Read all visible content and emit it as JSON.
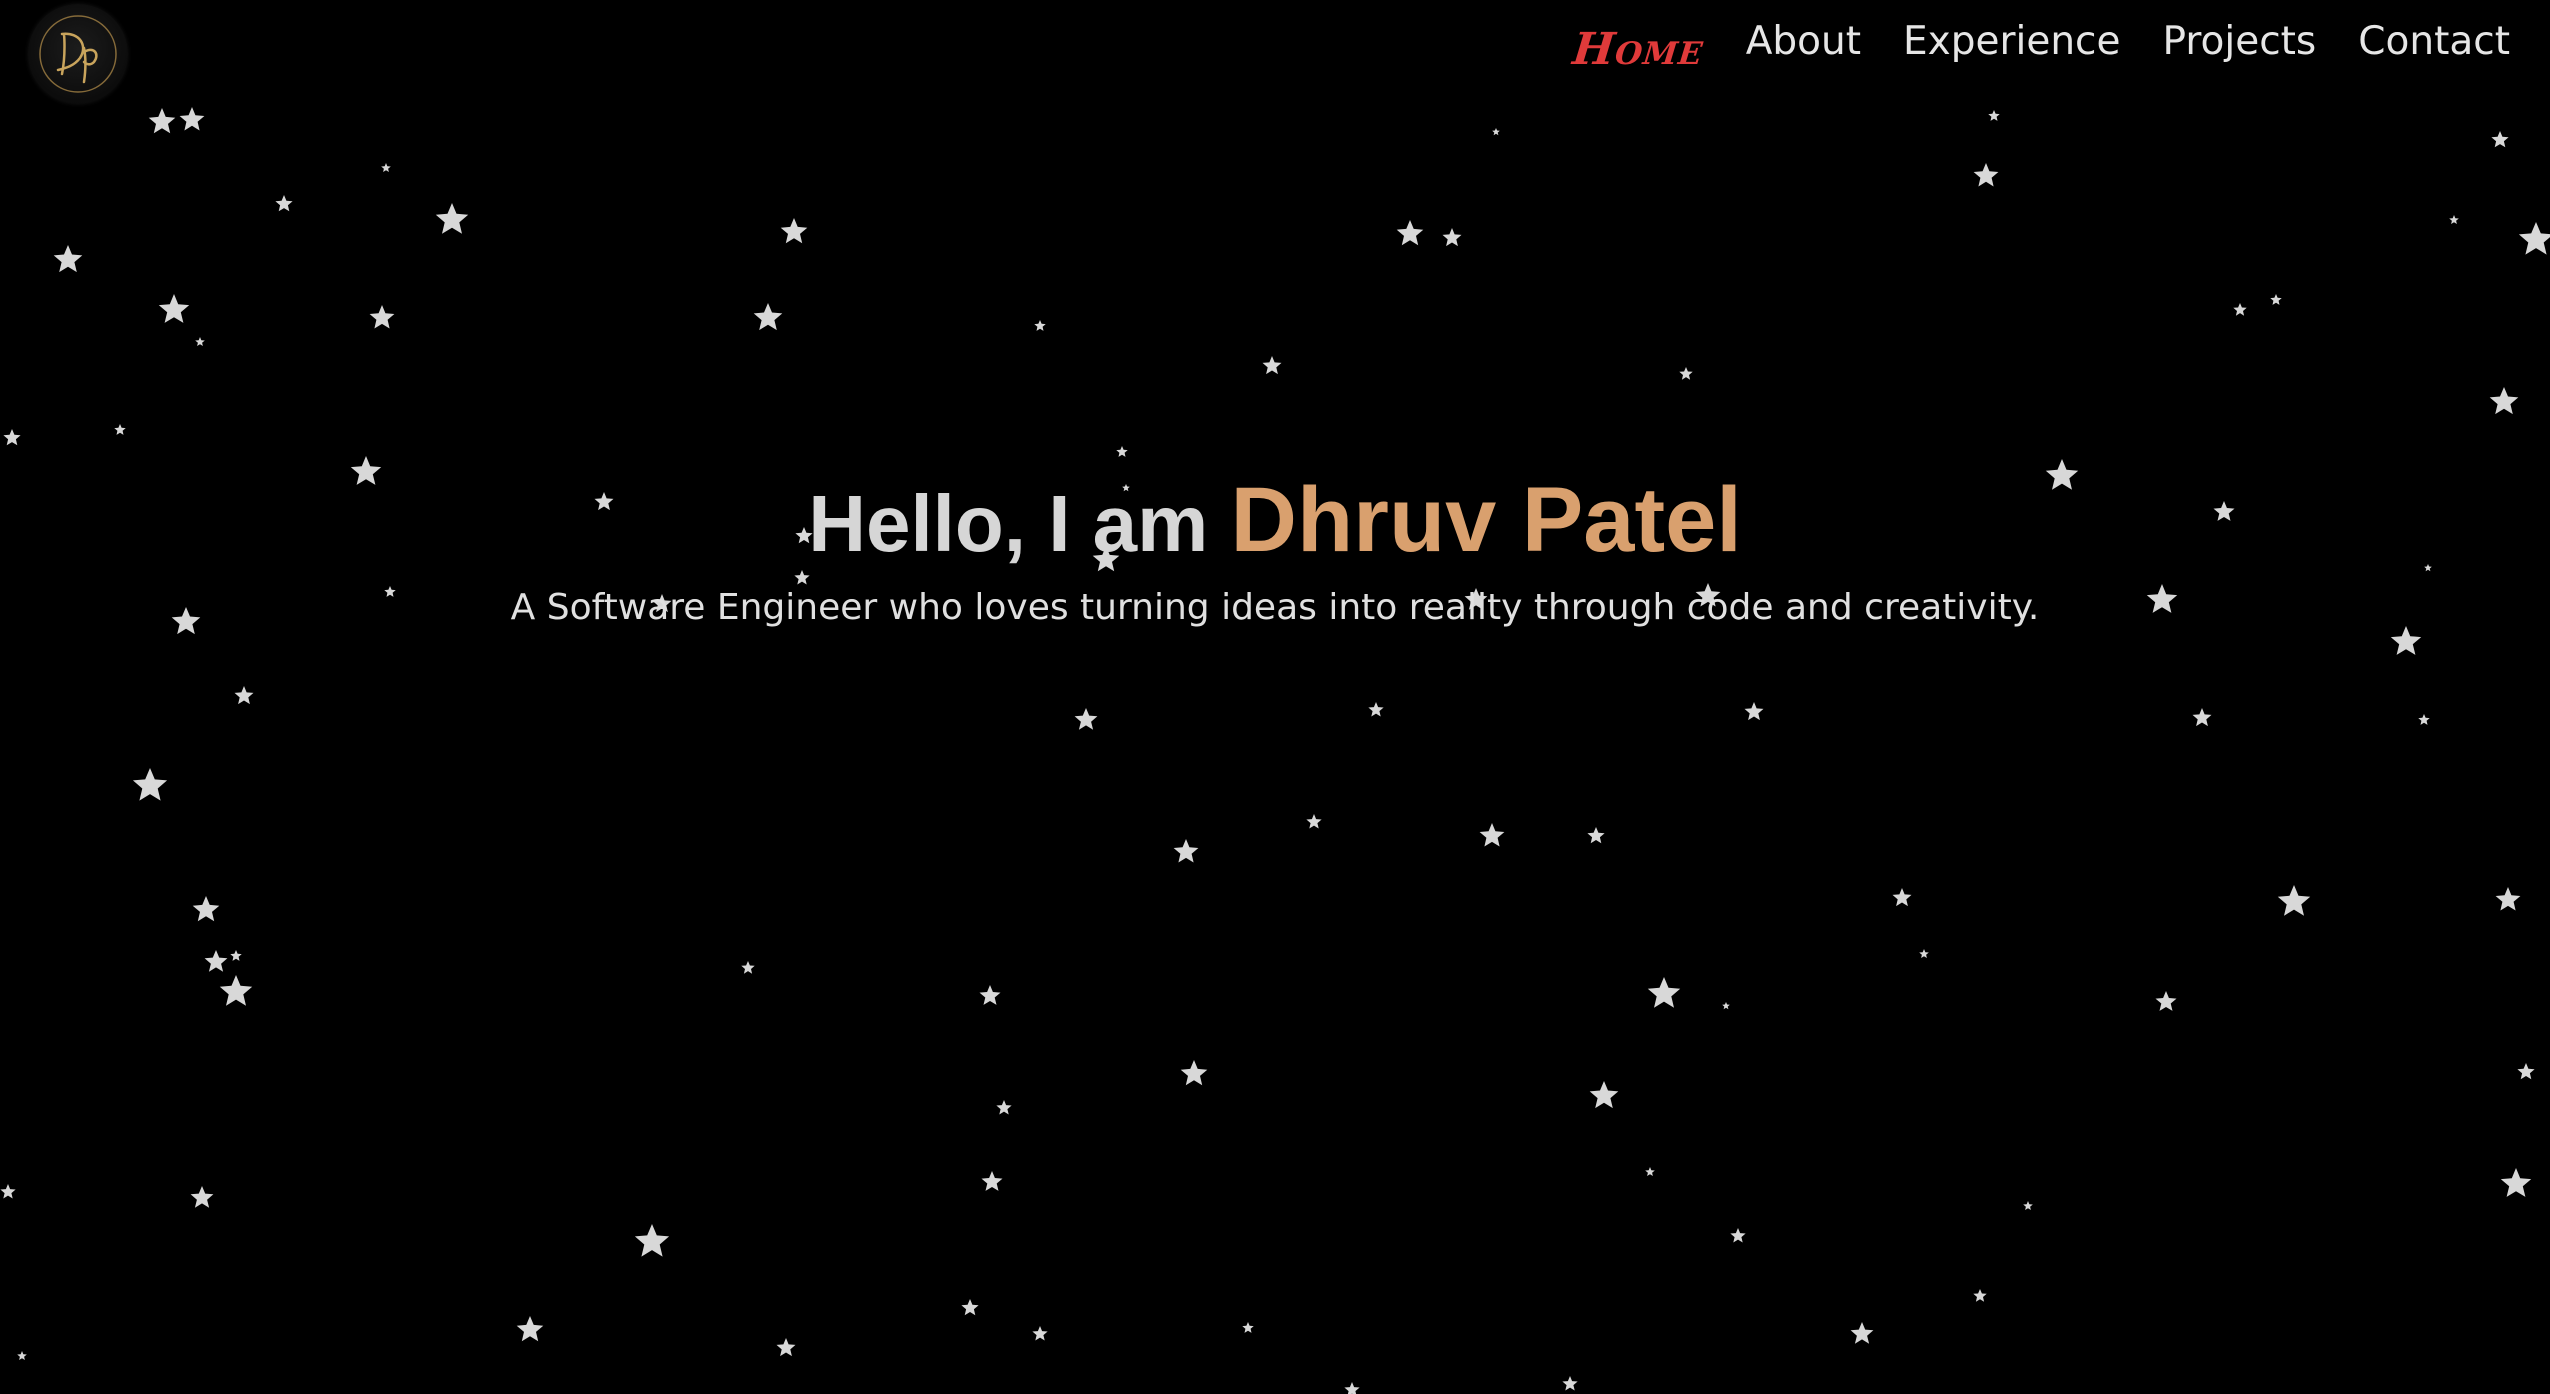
{
  "logo": {
    "initials": "Dp",
    "color": "#c9a45c"
  },
  "nav": {
    "items": [
      {
        "label": "Home",
        "active": true
      },
      {
        "label": "About",
        "active": false
      },
      {
        "label": "Experience",
        "active": false
      },
      {
        "label": "Projects",
        "active": false
      },
      {
        "label": "Contact",
        "active": false
      }
    ],
    "active_color": "#e03a3a"
  },
  "hero": {
    "greeting": "Hello, I am",
    "name": "Dhruv Patel",
    "tagline": "A Software Engineer who loves turning ideas into reality through code and creativity."
  },
  "colors": {
    "background": "#000000",
    "accent": "#d9a06e",
    "star": "#d8d8d8"
  },
  "background_icon": "star-icon"
}
